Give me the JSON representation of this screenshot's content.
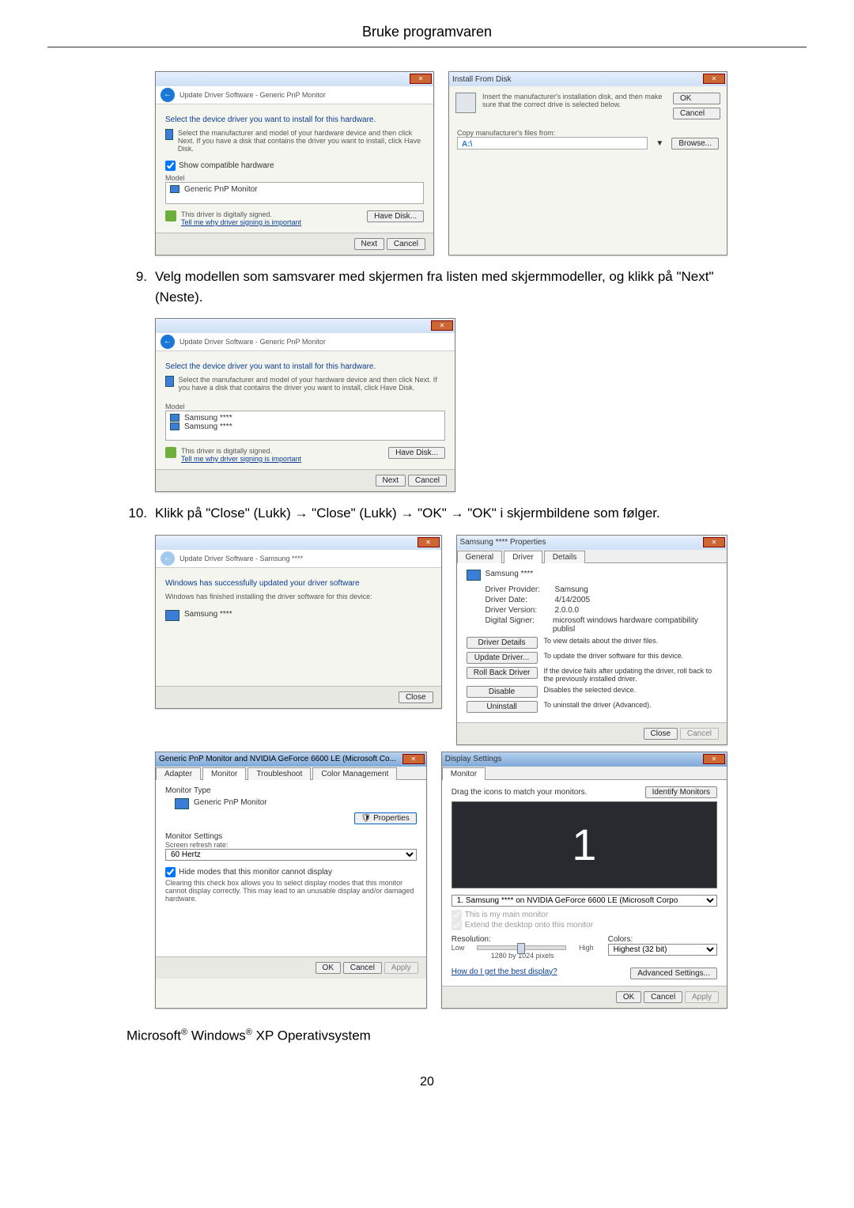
{
  "page": {
    "header": "Bruke programvaren",
    "number": "20"
  },
  "step9": {
    "num": "9.",
    "text": "Velg modellen som samsvarer med skjermen fra listen med skjermmodeller, og klikk på \"Next\" (Neste)."
  },
  "step10": {
    "num": "10.",
    "text": "Klikk på \"Close\" (Lukk) → \"Close\" (Lukk) → \"OK\" → \"OK\" i skjermbildene som følger."
  },
  "footer_text": {
    "a": "Microsoft",
    "b": " Windows",
    "c": " XP Operativsystem"
  },
  "wiz1": {
    "crumb": "Update Driver Software - Generic PnP Monitor",
    "h": "Select the device driver you want to install for this hardware.",
    "sub": "Select the manufacturer and model of your hardware device and then click Next. If you have a disk that contains the driver you want to install, click Have Disk.",
    "compat": "Show compatible hardware",
    "mlabel": "Model",
    "m1": "Generic PnP Monitor",
    "signed": "This driver is digitally signed.",
    "tell": "Tell me why driver signing is important",
    "hd": "Have Disk...",
    "next": "Next",
    "cancel": "Cancel"
  },
  "ifd": {
    "title": "Install From Disk",
    "msg": "Insert the manufacturer's installation disk, and then make sure that the correct drive is selected below.",
    "ok": "OK",
    "cancel": "Cancel",
    "copy": "Copy manufacturer's files from:",
    "browse": "Browse..."
  },
  "wiz2": {
    "crumb": "Update Driver Software - Generic PnP Monitor",
    "h": "Select the device driver you want to install for this hardware.",
    "sub": "Select the manufacturer and model of your hardware device and then click Next. If you have a disk that contains the driver you want to install, click Have Disk.",
    "mlabel": "Model",
    "m1": "Samsung ****",
    "m2": "Samsung ****",
    "signed": "This driver is digitally signed.",
    "tell": "Tell me why driver signing is important",
    "hd": "Have Disk...",
    "next": "Next",
    "cancel": "Cancel"
  },
  "wiz3": {
    "crumb": "Update Driver Software - Samsung ****",
    "h": "Windows has successfully updated your driver software",
    "sub": "Windows has finished installing the driver software for this device:",
    "dev": "Samsung ****",
    "close": "Close"
  },
  "props": {
    "title": "Samsung **** Properties",
    "tabs": {
      "general": "General",
      "driver": "Driver",
      "details": "Details"
    },
    "dev": "Samsung ****",
    "provider_k": "Driver Provider:",
    "provider_v": "Samsung",
    "date_k": "Driver Date:",
    "date_v": "4/14/2005",
    "ver_k": "Driver Version:",
    "ver_v": "2.0.0.0",
    "signer_k": "Digital Signer:",
    "signer_v": "microsoft windows hardware compatibility publisl",
    "b1": "Driver Details",
    "d1": "To view details about the driver files.",
    "b2": "Update Driver...",
    "d2": "To update the driver software for this device.",
    "b3": "Roll Back Driver",
    "d3": "If the device fails after updating the driver, roll back to the previously installed driver.",
    "b4": "Disable",
    "d4": "Disables the selected device.",
    "b5": "Uninstall",
    "d5": "To uninstall the driver (Advanced).",
    "close": "Close",
    "cancel": "Cancel"
  },
  "monprops": {
    "title": "Generic PnP Monitor and NVIDIA GeForce 6600 LE (Microsoft Co...",
    "tabs": {
      "adapter": "Adapter",
      "monitor": "Monitor",
      "trouble": "Troubleshoot",
      "color": "Color Management"
    },
    "mt": "Monitor Type",
    "dev": "Generic PnP Monitor",
    "pbtn": "Properties",
    "ms": "Monitor Settings",
    "srr": "Screen refresh rate:",
    "rate": "60 Hertz",
    "hide": "Hide modes that this monitor cannot display",
    "warn": "Clearing this check box allows you to select display modes that this monitor cannot display correctly. This may lead to an unusable display and/or damaged hardware.",
    "ok": "OK",
    "cancel": "Cancel",
    "apply": "Apply"
  },
  "disp": {
    "title": "Display Settings",
    "tab": "Monitor",
    "drag": "Drag the icons to match your monitors.",
    "ident": "Identify Monitors",
    "one": "1",
    "sel": "1. Samsung **** on NVIDIA GeForce 6600 LE (Microsoft Corpo",
    "cb1": "This is my main monitor",
    "cb2": "Extend the desktop onto this monitor",
    "res": "Resolution:",
    "low": "Low",
    "high": "High",
    "resval": "1280 by 1024 pixels",
    "colors": "Colors:",
    "colsel": "Highest (32 bit)",
    "link": "How do I get the best display?",
    "adv": "Advanced Settings...",
    "ok": "OK",
    "cancel": "Cancel",
    "apply": "Apply"
  }
}
